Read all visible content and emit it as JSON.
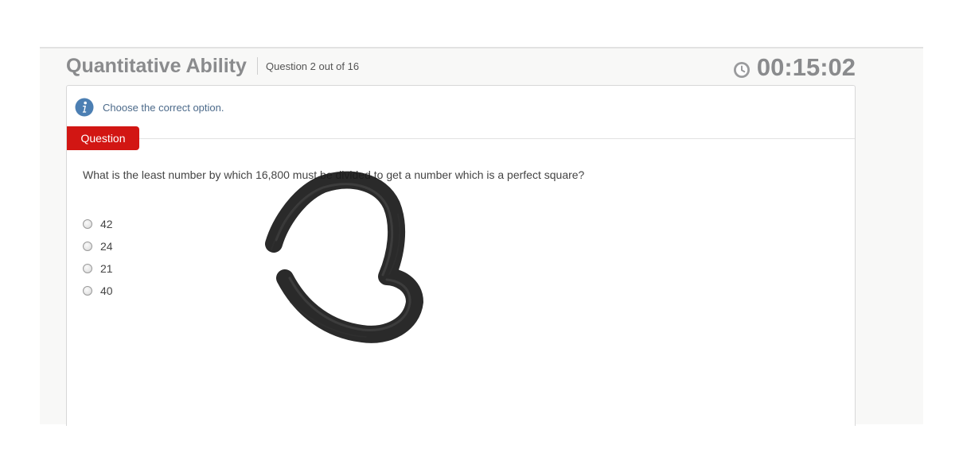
{
  "header": {
    "section_title": "Quantitative Ability",
    "question_counter": "Question 2 out of 16",
    "timer": "00:15:02",
    "timer_icon": "clock-icon"
  },
  "instruction": {
    "icon": "info-icon",
    "text": "Choose the correct option."
  },
  "question_tab_label": "Question",
  "question": {
    "text": "What is the least number by which 16,800 must be divided to get a number which is a perfect square?",
    "options": [
      "42",
      "24",
      "21",
      "40"
    ]
  },
  "colors": {
    "accent_red": "#d21613",
    "title_gray": "#8a8b8d",
    "info_blue": "#4c7fb3"
  }
}
